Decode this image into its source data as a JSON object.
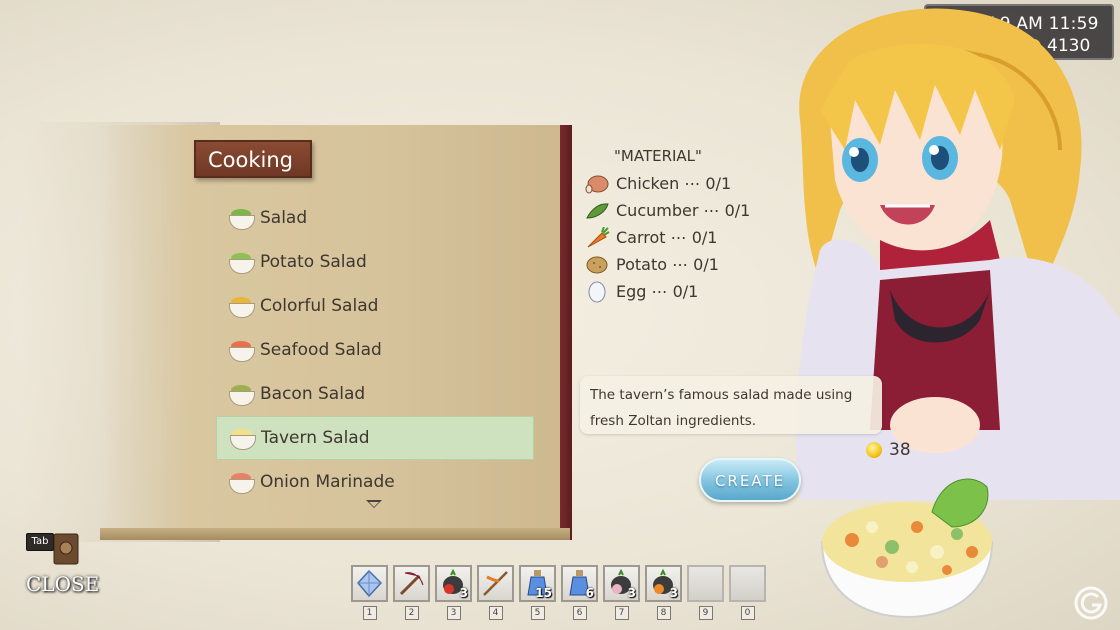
{
  "hud": {
    "daytime": "DAY 9 AM 11:59",
    "gold": "4130"
  },
  "book": {
    "title": "Cooking",
    "recipes": [
      {
        "label": "Salad",
        "icon": "salad-icon",
        "color": "#7ab648"
      },
      {
        "label": "Potato Salad",
        "icon": "potato-salad-icon",
        "color": "#8fbf55"
      },
      {
        "label": "Colorful Salad",
        "icon": "colorful-salad-icon",
        "color": "#e9b43a"
      },
      {
        "label": "Seafood Salad",
        "icon": "seafood-salad-icon",
        "color": "#e8704a"
      },
      {
        "label": "Bacon Salad",
        "icon": "bacon-salad-icon",
        "color": "#9cb050"
      },
      {
        "label": "Tavern Salad",
        "icon": "tavern-salad-icon",
        "color": "#f2e08a",
        "selected": true
      },
      {
        "label": "Onion Marinade",
        "icon": "onion-marinade-icon",
        "color": "#e8806a"
      }
    ]
  },
  "materials": {
    "title": "\"MATERIAL\"",
    "items": [
      {
        "label": "Chicken ⋯ 0/1",
        "icon": "chicken-icon"
      },
      {
        "label": "Cucumber ⋯ 0/1",
        "icon": "cucumber-icon"
      },
      {
        "label": "Carrot ⋯ 0/1",
        "icon": "carrot-icon"
      },
      {
        "label": "Potato ⋯ 0/1",
        "icon": "potato-icon"
      },
      {
        "label": "Egg ⋯ 0/1",
        "icon": "egg-icon"
      }
    ]
  },
  "description": {
    "line1": "The tavern’s famous salad made using",
    "line2": "fresh Zoltan ingredients."
  },
  "price": "38",
  "create_label": "CREATE",
  "close": {
    "key": "Tab",
    "label": "CLOSE"
  },
  "hotbar": [
    {
      "num": "1",
      "icon": "crystal-icon",
      "count": ""
    },
    {
      "num": "2",
      "icon": "pickaxe-icon",
      "count": ""
    },
    {
      "num": "3",
      "icon": "tomato-seed-bag-icon",
      "count": "3"
    },
    {
      "num": "4",
      "icon": "fishing-rod-icon",
      "count": ""
    },
    {
      "num": "5",
      "icon": "blue-potion-icon",
      "count": "15"
    },
    {
      "num": "6",
      "icon": "blue-potion-icon",
      "count": "6"
    },
    {
      "num": "7",
      "icon": "turnip-seed-bag-icon",
      "count": "3"
    },
    {
      "num": "8",
      "icon": "carrot-seed-bag-icon",
      "count": "3"
    },
    {
      "num": "9",
      "icon": "",
      "count": ""
    },
    {
      "num": "0",
      "icon": "",
      "count": ""
    }
  ]
}
